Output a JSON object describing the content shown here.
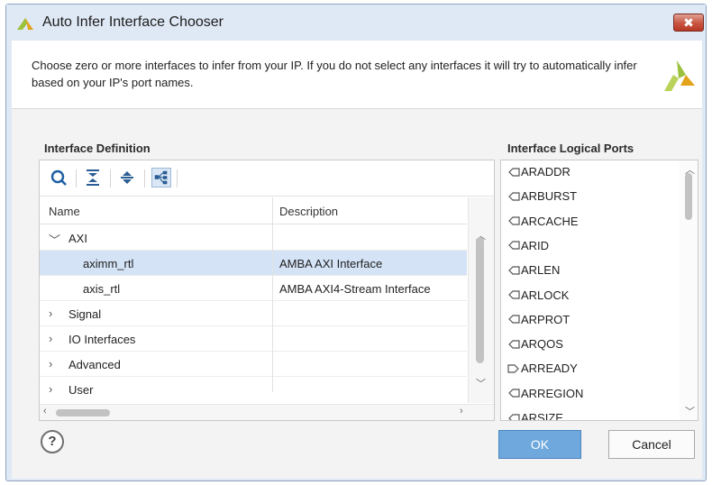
{
  "window": {
    "title": "Auto Infer Interface Chooser",
    "close_glyph": "✖"
  },
  "banner": {
    "text": "Choose zero or more interfaces to infer from your IP. If you do not select any interfaces it will try to automatically infer based on your IP's port names."
  },
  "left": {
    "label": "Interface Definition",
    "toolbar": [
      "search-icon",
      "collapse-all-icon",
      "expand-all-icon",
      "hierarchy-icon"
    ],
    "columns": {
      "name": "Name",
      "description": "Description"
    },
    "rows": [
      {
        "name": "AXI",
        "description": "",
        "expanded": true,
        "level": 0
      },
      {
        "name": "aximm_rtl",
        "description": "AMBA AXI Interface",
        "level": 1,
        "selected": true
      },
      {
        "name": "axis_rtl",
        "description": "AMBA AXI4-Stream Interface",
        "level": 1
      },
      {
        "name": "Signal",
        "description": "",
        "expanded": false,
        "level": 0
      },
      {
        "name": "IO Interfaces",
        "description": "",
        "expanded": false,
        "level": 0
      },
      {
        "name": "Advanced",
        "description": "",
        "expanded": false,
        "level": 0
      },
      {
        "name": "User",
        "description": "",
        "expanded": false,
        "level": 0
      }
    ]
  },
  "right": {
    "label": "Interface Logical Ports",
    "ports": [
      {
        "name": "ARADDR",
        "direction": "in"
      },
      {
        "name": "ARBURST",
        "direction": "in"
      },
      {
        "name": "ARCACHE",
        "direction": "in"
      },
      {
        "name": "ARID",
        "direction": "in"
      },
      {
        "name": "ARLEN",
        "direction": "in"
      },
      {
        "name": "ARLOCK",
        "direction": "in"
      },
      {
        "name": "ARPROT",
        "direction": "in"
      },
      {
        "name": "ARQOS",
        "direction": "in"
      },
      {
        "name": "ARREADY",
        "direction": "out"
      },
      {
        "name": "ARREGION",
        "direction": "in"
      },
      {
        "name": "ARSIZE",
        "direction": "in"
      }
    ]
  },
  "buttons": {
    "help": "?",
    "ok": "OK",
    "cancel": "Cancel"
  },
  "colors": {
    "ok_button": "#6fa8dc",
    "selection": "#d4e3f6",
    "close_button": "#c8543f"
  }
}
